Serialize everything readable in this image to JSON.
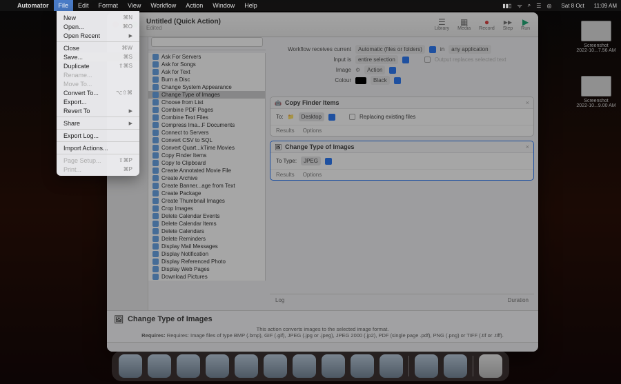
{
  "menubar": {
    "app": "Automator",
    "items": [
      "File",
      "Edit",
      "Format",
      "View",
      "Workflow",
      "Action",
      "Window",
      "Help"
    ],
    "status": {
      "date": "Sat 8 Oct",
      "time": "11:09 AM"
    }
  },
  "desktop_files": [
    {
      "name": "Screenshot",
      "sub": "2022-10...7.56 AM"
    },
    {
      "name": "Screenshot",
      "sub": "2022-10...9.00 AM"
    }
  ],
  "window": {
    "title": "Untitled (Quick Action)",
    "subtitle": "Edited",
    "toolbar": [
      {
        "label": "Library",
        "glyph": "☰"
      },
      {
        "label": "Media",
        "glyph": "▦"
      },
      {
        "label": "Record",
        "glyph": "●"
      },
      {
        "label": "Step",
        "glyph": "▸▸"
      },
      {
        "label": "Run",
        "glyph": "▶"
      }
    ],
    "search_placeholder": "",
    "actions": [
      "Ask For Servers",
      "Ask for Songs",
      "Ask for Text",
      "Burn a Disc",
      "Change System Appearance",
      "Change Type of Images",
      "Choose from List",
      "Combine PDF Pages",
      "Combine Text Files",
      "Compress Ima...F Documents",
      "Connect to Servers",
      "Convert CSV to SQL",
      "Convert Quart...kTime Movies",
      "Copy Finder Items",
      "Copy to Clipboard",
      "Create Annotated Movie File",
      "Create Archive",
      "Create Banner...age from Text",
      "Create Package",
      "Create Thumbnail Images",
      "Crop Images",
      "Delete Calendar Events",
      "Delete Calendar Items",
      "Delete Calendars",
      "Delete Reminders",
      "Display Mail Messages",
      "Display Notification",
      "Display Referenced Photo",
      "Display Web Pages",
      "Download Pictures"
    ],
    "actions_selected": "Change Type of Images",
    "wf_header": {
      "l1_label": "Workflow receives current",
      "l1_val": "Automatic (files or folders)",
      "l1_in": "in",
      "l1_app": "any application",
      "l2_label": "Input is",
      "l2_val": "entire selection",
      "l2_chk": "Output replaces selected text",
      "l3_label": "Image",
      "l3_val": "Action",
      "l4_label": "Colour",
      "l4_val": "Black"
    },
    "card1": {
      "title": "Copy Finder Items",
      "to": "To:",
      "dest": "Desktop",
      "replace": "Replacing existing files",
      "results": "Results",
      "options": "Options"
    },
    "card2": {
      "title": "Change Type of Images",
      "to": "To Type:",
      "type": "JPEG",
      "results": "Results",
      "options": "Options"
    },
    "logbar": {
      "log": "Log",
      "duration": "Duration"
    },
    "desc": {
      "title": "Change Type of Images",
      "body": "This action converts images to the selected image format.",
      "req": "Requires: Image files of type BMP (.bmp), GIF (.gif), JPEG (.jpg or .jpeg), JPEG 2000 (.jp2), PDF (single page .pdf), PNG (.png) or TIFF (.tif or .tiff)."
    }
  },
  "file_menu": [
    {
      "label": "New",
      "sc": "⌘N"
    },
    {
      "label": "Open...",
      "sc": "⌘O"
    },
    {
      "label": "Open Recent",
      "arrow": true
    },
    {
      "sep": true
    },
    {
      "label": "Close",
      "sc": "⌘W"
    },
    {
      "label": "Save...",
      "sc": "⌘S",
      "hl": true
    },
    {
      "label": "Duplicate",
      "sc": "⇧⌘S"
    },
    {
      "label": "Rename...",
      "dis": true
    },
    {
      "label": "Move To...",
      "dis": true
    },
    {
      "label": "Convert To...",
      "sc": "⌥⇧⌘"
    },
    {
      "label": "Export...",
      "sc": ""
    },
    {
      "label": "Revert To",
      "arrow": true
    },
    {
      "sep": true
    },
    {
      "label": "Share",
      "arrow": true
    },
    {
      "sep": true
    },
    {
      "label": "Export Log..."
    },
    {
      "sep": true
    },
    {
      "label": "Import Actions..."
    },
    {
      "sep": true
    },
    {
      "label": "Page Setup...",
      "sc": "⇧⌘P",
      "dis": true
    },
    {
      "label": "Print...",
      "sc": "⌘P",
      "dis": true
    }
  ]
}
